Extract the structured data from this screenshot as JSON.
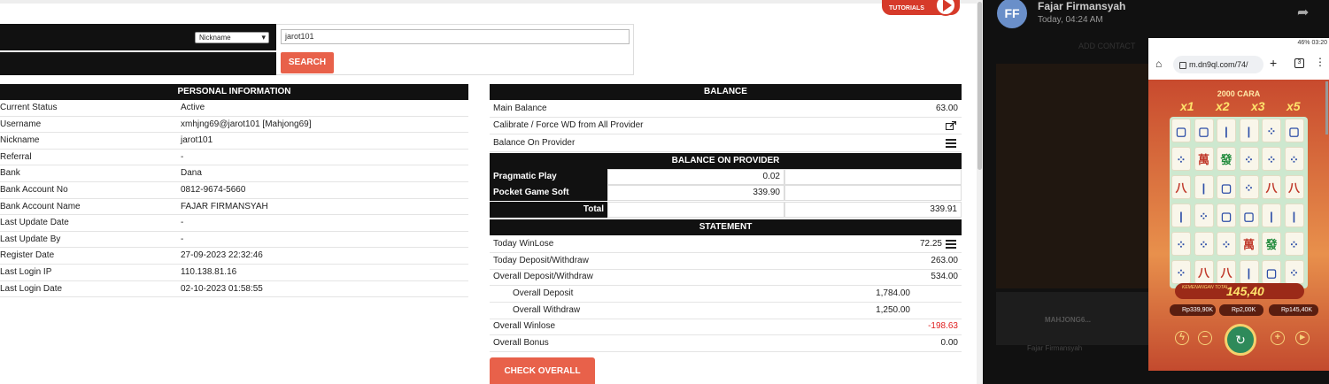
{
  "header": {
    "tutorials_label": "TUTORIALS"
  },
  "search": {
    "type_selected": "Nickname",
    "value": "jarot101",
    "button_label": "SEARCH"
  },
  "personal": {
    "title": "PERSONAL INFORMATION",
    "rows": [
      {
        "label": "Current Status",
        "value": "Active"
      },
      {
        "label": "Username",
        "value": "xmhjng69@jarot101  [Mahjong69]"
      },
      {
        "label": "Nickname",
        "value": "jarot101"
      },
      {
        "label": "Referral",
        "value": "-"
      },
      {
        "label": "Bank",
        "value": "Dana"
      },
      {
        "label": "Bank Account No",
        "value": "0812-9674-5660"
      },
      {
        "label": "Bank Account Name",
        "value": "FAJAR FIRMANSYAH"
      },
      {
        "label": "Last Update Date",
        "value": "-"
      },
      {
        "label": "Last Update By",
        "value": "-"
      },
      {
        "label": "Register Date",
        "value": "27-09-2023 22:32:46"
      },
      {
        "label": "Last Login IP",
        "value": "110.138.81.16"
      },
      {
        "label": "Last Login Date",
        "value": "02-10-2023 01:58:55"
      }
    ]
  },
  "balance": {
    "title": "BALANCE",
    "main_label": "Main Balance",
    "main_value": "63.00",
    "calibrate_label": "Calibrate / Force WD from All Provider",
    "on_provider_label": "Balance On Provider"
  },
  "provider": {
    "title": "BALANCE ON PROVIDER",
    "rows": [
      {
        "label": "Pragmatic Play",
        "value": "0.02"
      },
      {
        "label": "Pocket Game Soft",
        "value": "339.90"
      }
    ],
    "total_label": "Total",
    "total_value": "339.91"
  },
  "statement": {
    "title": "STATEMENT",
    "today_winlose_label": "Today WinLose",
    "today_winlose_value": "72.25",
    "today_dw_label": "Today Deposit/Withdraw",
    "today_dw_value": "263.00",
    "overall_dw_label": "Overall Deposit/Withdraw",
    "overall_dw_value": "534.00",
    "overall_deposit_label": "Overall Deposit",
    "overall_deposit_value": "1,784.00",
    "overall_withdraw_label": "Overall Withdraw",
    "overall_withdraw_value": "1,250.00",
    "overall_winlose_label": "Overall Winlose",
    "overall_winlose_value": "-198.63",
    "overall_bonus_label": "Overall Bonus",
    "overall_bonus_value": "0.00",
    "check_button": "CHECK OVERALL"
  },
  "chat": {
    "avatar_initials": "FF",
    "sender": "Fajar Firmansyah",
    "time": "Today, 04:24 AM",
    "add_contact": "ADD CONTACT",
    "bg_chat_title": "MAHJONG6...",
    "bg_chat_name": "Fajar Firmansyah"
  },
  "phone": {
    "status_right": "46% 03:20",
    "url": "m.dn9ql.com/74/",
    "tabs_count": "3",
    "game": {
      "title": "2000 CARA",
      "multipliers": [
        "x1",
        "x2",
        "x3",
        "x5"
      ],
      "win_label": "KEMENANGAN TOTAL",
      "win_value": "145,40",
      "pills": [
        "Rp339,90K",
        "Rp2,00K",
        "Rp145,40K"
      ]
    }
  },
  "colors": {
    "accent": "#e8614a",
    "header_bg": "#111111",
    "negative": "#e02020"
  }
}
